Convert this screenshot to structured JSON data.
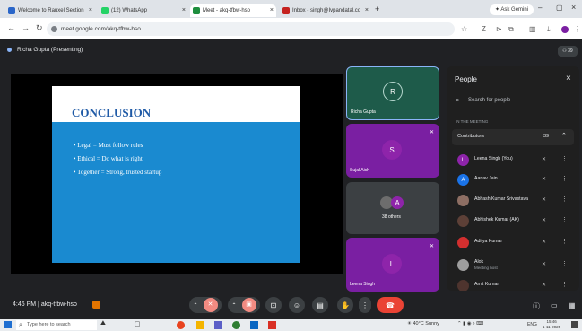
{
  "browser": {
    "tabs": [
      {
        "label": "Welcome to Rauxel Section",
        "fav_color": "#2a66c9"
      },
      {
        "label": "(12) WhatsApp",
        "fav_color": "#25d366"
      },
      {
        "label": "Meet - akq-tfbw-hso",
        "fav_color": "#1e8e3e"
      },
      {
        "label": "Inbox - singh@Ivpandatal.co",
        "fav_color": "#c5221f"
      }
    ],
    "new_tab": "+",
    "address": "meet.google.com/akq-tfbw-hso",
    "ask_gemini": "Ask Gemini"
  },
  "meet": {
    "presenting_label": "Richa Gupta (Presenting)",
    "participant_count_badge": "39",
    "slide": {
      "title": "CONCLUSION",
      "bullets": [
        "• Legal = Must follow rules",
        "• Ethical = Do what is right",
        "• Together = Strong, trusted startup"
      ]
    },
    "tiles": [
      {
        "initial": "R",
        "name": "Richa Gupta",
        "bg": "#1e5b4a",
        "av": "#1e5b4a"
      },
      {
        "initial": "S",
        "name": "Sujal Aich",
        "bg": "#7a1fa2",
        "av": "#8e24aa"
      },
      {
        "initial": "A",
        "name": "38 others",
        "bg": "#3c4043",
        "av": "#8e24aa"
      },
      {
        "initial": "L",
        "name": "Leena Singh",
        "bg": "#7a1fa2",
        "av": "#8e24aa"
      }
    ],
    "people": {
      "title": "People",
      "search_placeholder": "Search for people",
      "section": "IN THE MEETING",
      "contributors_label": "Contributors",
      "contributors_count": "39",
      "list": [
        {
          "initial": "L",
          "name": "Leena Singh (You)",
          "sub": "",
          "color": "#8e24aa"
        },
        {
          "initial": "A",
          "name": "Aarjav Jain",
          "sub": "",
          "color": "#1a73e8"
        },
        {
          "initial": "",
          "name": "Abhash Kumar Srivastava",
          "sub": "",
          "color": "#8d6e63"
        },
        {
          "initial": "",
          "name": "Abhishek Kumar (AK)",
          "sub": "",
          "color": "#5d4037"
        },
        {
          "initial": "",
          "name": "Aditya Kumar",
          "sub": "",
          "color": "#d32f2f"
        },
        {
          "initial": "",
          "name": "Alok",
          "sub": "Meeting host",
          "color": "#9e9e9e"
        },
        {
          "initial": "",
          "name": "Amit Kumar",
          "sub": "",
          "color": "#4e342e"
        }
      ]
    },
    "footer": {
      "time": "4:46 PM",
      "separator": "|",
      "code": "akq-tfbw-hso"
    }
  },
  "taskbar": {
    "search_placeholder": "Type here to search",
    "weather": "40°C Sunny",
    "lang": "ENG",
    "clock_time": "15:46",
    "clock_date": "1-11-2025"
  }
}
